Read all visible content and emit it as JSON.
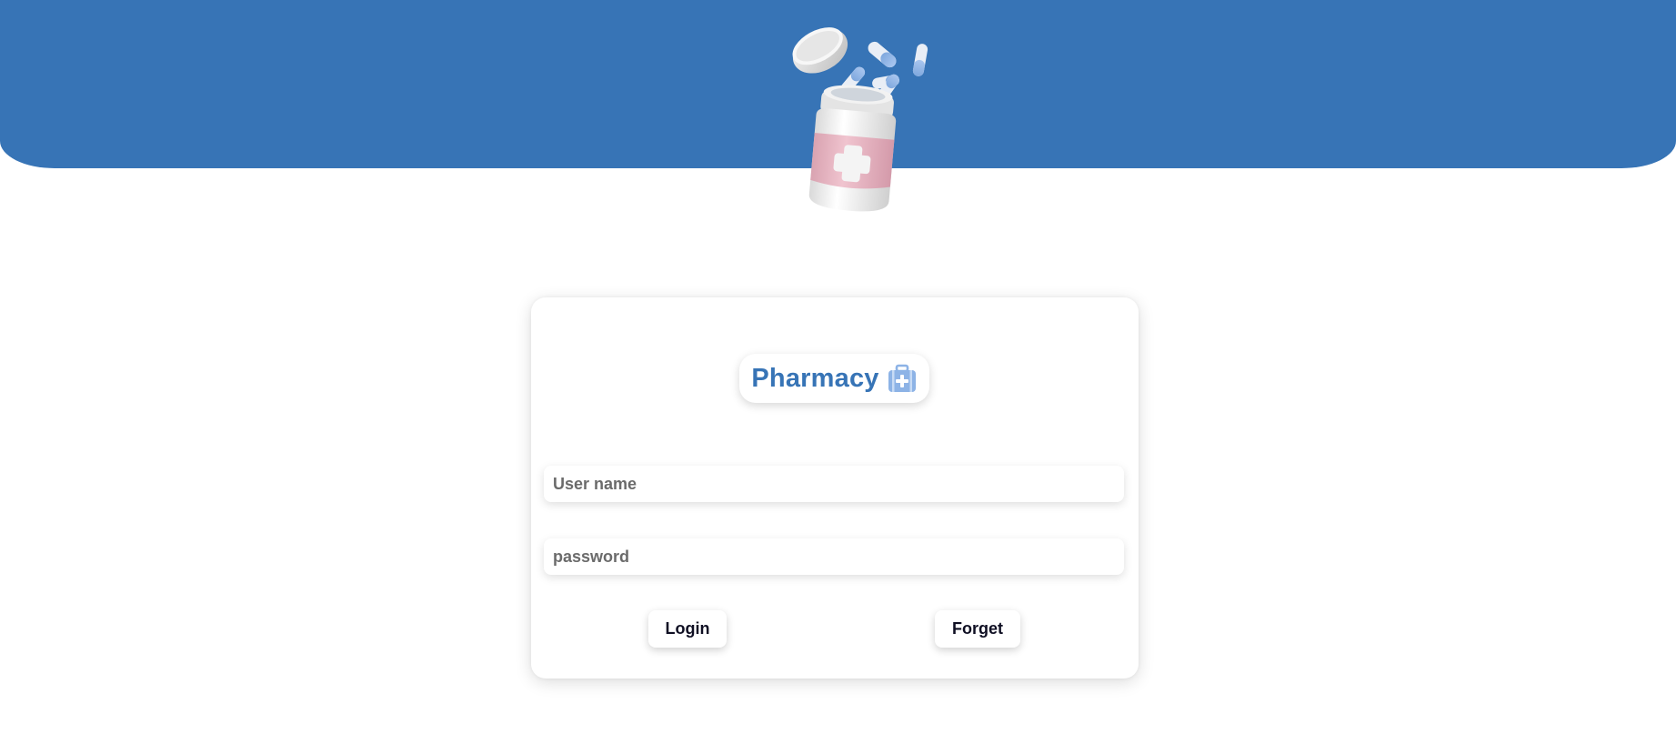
{
  "header": {
    "hero_image": "pill-bottle-with-capsules-illustration",
    "band_color": "#3774b6"
  },
  "login": {
    "brand_title": "Pharmacy",
    "brand_icon": "first-aid-kit-icon",
    "brand_color": "#3774b6",
    "username_placeholder": "User name",
    "username_value": "",
    "password_placeholder": "password",
    "password_value": "",
    "login_label": "Login",
    "forget_label": "Forget"
  }
}
